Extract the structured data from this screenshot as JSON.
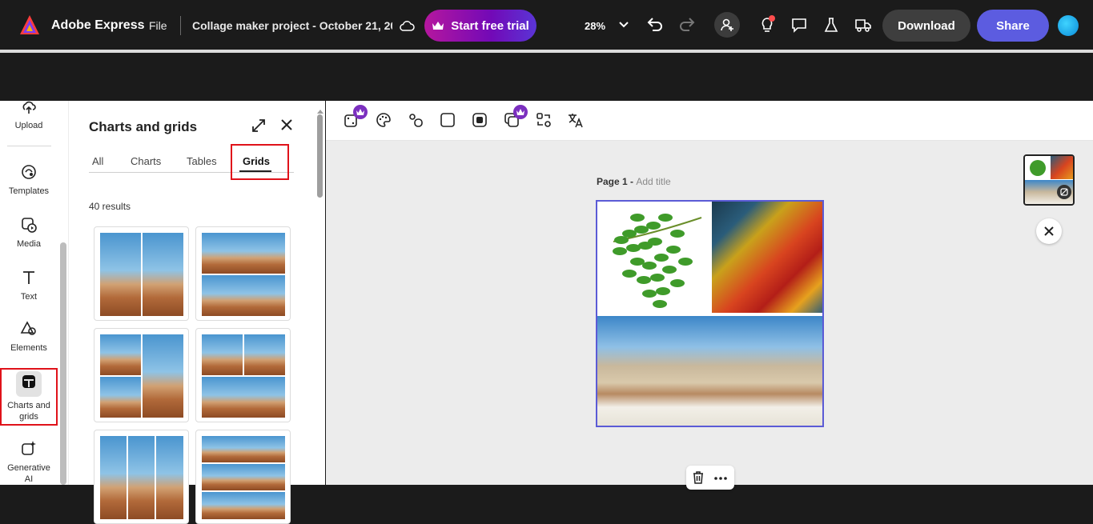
{
  "topbar": {
    "app_name": "Adobe Express",
    "file_menu": "File",
    "project_title": "Collage maker project - October 21, 202...",
    "trial_button": "Start free trial",
    "zoom": "28%",
    "download_button": "Download",
    "share_button": "Share"
  },
  "left_rail": {
    "items": [
      {
        "label": "Upload",
        "icon": "upload-icon"
      },
      {
        "label": "Templates",
        "icon": "templates-icon"
      },
      {
        "label": "Media",
        "icon": "media-icon"
      },
      {
        "label": "Text",
        "icon": "text-icon"
      },
      {
        "label": "Elements",
        "icon": "elements-icon"
      },
      {
        "label": "Charts and grids",
        "icon": "charts-grids-icon"
      },
      {
        "label": "Generative AI",
        "icon": "generative-ai-icon"
      }
    ]
  },
  "panel": {
    "title": "Charts and grids",
    "tabs": [
      "All",
      "Charts",
      "Tables",
      "Grids"
    ],
    "active_tab": "Grids",
    "results": "40 results"
  },
  "canvas": {
    "page_label": "Page 1 - ",
    "page_title_placeholder": "Add title"
  },
  "colors": {
    "accent": "#5c5ce0",
    "highlight": "#e0121a",
    "topbar_bg": "#1b1b1b"
  }
}
